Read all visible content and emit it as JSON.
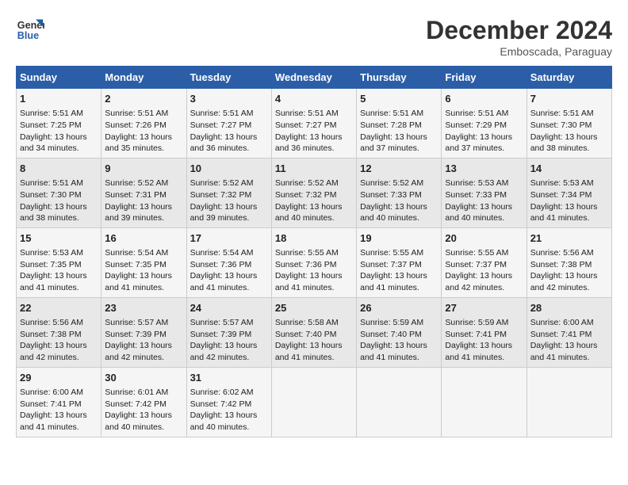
{
  "header": {
    "logo_line1": "General",
    "logo_line2": "Blue",
    "month": "December 2024",
    "location": "Emboscada, Paraguay"
  },
  "days_of_week": [
    "Sunday",
    "Monday",
    "Tuesday",
    "Wednesday",
    "Thursday",
    "Friday",
    "Saturday"
  ],
  "weeks": [
    [
      {
        "day": 1,
        "data": "Sunrise: 5:51 AM\nSunset: 7:25 PM\nDaylight: 13 hours\nand 34 minutes."
      },
      {
        "day": 2,
        "data": "Sunrise: 5:51 AM\nSunset: 7:26 PM\nDaylight: 13 hours\nand 35 minutes."
      },
      {
        "day": 3,
        "data": "Sunrise: 5:51 AM\nSunset: 7:27 PM\nDaylight: 13 hours\nand 36 minutes."
      },
      {
        "day": 4,
        "data": "Sunrise: 5:51 AM\nSunset: 7:27 PM\nDaylight: 13 hours\nand 36 minutes."
      },
      {
        "day": 5,
        "data": "Sunrise: 5:51 AM\nSunset: 7:28 PM\nDaylight: 13 hours\nand 37 minutes."
      },
      {
        "day": 6,
        "data": "Sunrise: 5:51 AM\nSunset: 7:29 PM\nDaylight: 13 hours\nand 37 minutes."
      },
      {
        "day": 7,
        "data": "Sunrise: 5:51 AM\nSunset: 7:30 PM\nDaylight: 13 hours\nand 38 minutes."
      }
    ],
    [
      {
        "day": 8,
        "data": "Sunrise: 5:51 AM\nSunset: 7:30 PM\nDaylight: 13 hours\nand 38 minutes."
      },
      {
        "day": 9,
        "data": "Sunrise: 5:52 AM\nSunset: 7:31 PM\nDaylight: 13 hours\nand 39 minutes."
      },
      {
        "day": 10,
        "data": "Sunrise: 5:52 AM\nSunset: 7:32 PM\nDaylight: 13 hours\nand 39 minutes."
      },
      {
        "day": 11,
        "data": "Sunrise: 5:52 AM\nSunset: 7:32 PM\nDaylight: 13 hours\nand 40 minutes."
      },
      {
        "day": 12,
        "data": "Sunrise: 5:52 AM\nSunset: 7:33 PM\nDaylight: 13 hours\nand 40 minutes."
      },
      {
        "day": 13,
        "data": "Sunrise: 5:53 AM\nSunset: 7:33 PM\nDaylight: 13 hours\nand 40 minutes."
      },
      {
        "day": 14,
        "data": "Sunrise: 5:53 AM\nSunset: 7:34 PM\nDaylight: 13 hours\nand 41 minutes."
      }
    ],
    [
      {
        "day": 15,
        "data": "Sunrise: 5:53 AM\nSunset: 7:35 PM\nDaylight: 13 hours\nand 41 minutes."
      },
      {
        "day": 16,
        "data": "Sunrise: 5:54 AM\nSunset: 7:35 PM\nDaylight: 13 hours\nand 41 minutes."
      },
      {
        "day": 17,
        "data": "Sunrise: 5:54 AM\nSunset: 7:36 PM\nDaylight: 13 hours\nand 41 minutes."
      },
      {
        "day": 18,
        "data": "Sunrise: 5:55 AM\nSunset: 7:36 PM\nDaylight: 13 hours\nand 41 minutes."
      },
      {
        "day": 19,
        "data": "Sunrise: 5:55 AM\nSunset: 7:37 PM\nDaylight: 13 hours\nand 41 minutes."
      },
      {
        "day": 20,
        "data": "Sunrise: 5:55 AM\nSunset: 7:37 PM\nDaylight: 13 hours\nand 42 minutes."
      },
      {
        "day": 21,
        "data": "Sunrise: 5:56 AM\nSunset: 7:38 PM\nDaylight: 13 hours\nand 42 minutes."
      }
    ],
    [
      {
        "day": 22,
        "data": "Sunrise: 5:56 AM\nSunset: 7:38 PM\nDaylight: 13 hours\nand 42 minutes."
      },
      {
        "day": 23,
        "data": "Sunrise: 5:57 AM\nSunset: 7:39 PM\nDaylight: 13 hours\nand 42 minutes."
      },
      {
        "day": 24,
        "data": "Sunrise: 5:57 AM\nSunset: 7:39 PM\nDaylight: 13 hours\nand 42 minutes."
      },
      {
        "day": 25,
        "data": "Sunrise: 5:58 AM\nSunset: 7:40 PM\nDaylight: 13 hours\nand 41 minutes."
      },
      {
        "day": 26,
        "data": "Sunrise: 5:59 AM\nSunset: 7:40 PM\nDaylight: 13 hours\nand 41 minutes."
      },
      {
        "day": 27,
        "data": "Sunrise: 5:59 AM\nSunset: 7:41 PM\nDaylight: 13 hours\nand 41 minutes."
      },
      {
        "day": 28,
        "data": "Sunrise: 6:00 AM\nSunset: 7:41 PM\nDaylight: 13 hours\nand 41 minutes."
      }
    ],
    [
      {
        "day": 29,
        "data": "Sunrise: 6:00 AM\nSunset: 7:41 PM\nDaylight: 13 hours\nand 41 minutes."
      },
      {
        "day": 30,
        "data": "Sunrise: 6:01 AM\nSunset: 7:42 PM\nDaylight: 13 hours\nand 40 minutes."
      },
      {
        "day": 31,
        "data": "Sunrise: 6:02 AM\nSunset: 7:42 PM\nDaylight: 13 hours\nand 40 minutes."
      },
      null,
      null,
      null,
      null
    ]
  ]
}
